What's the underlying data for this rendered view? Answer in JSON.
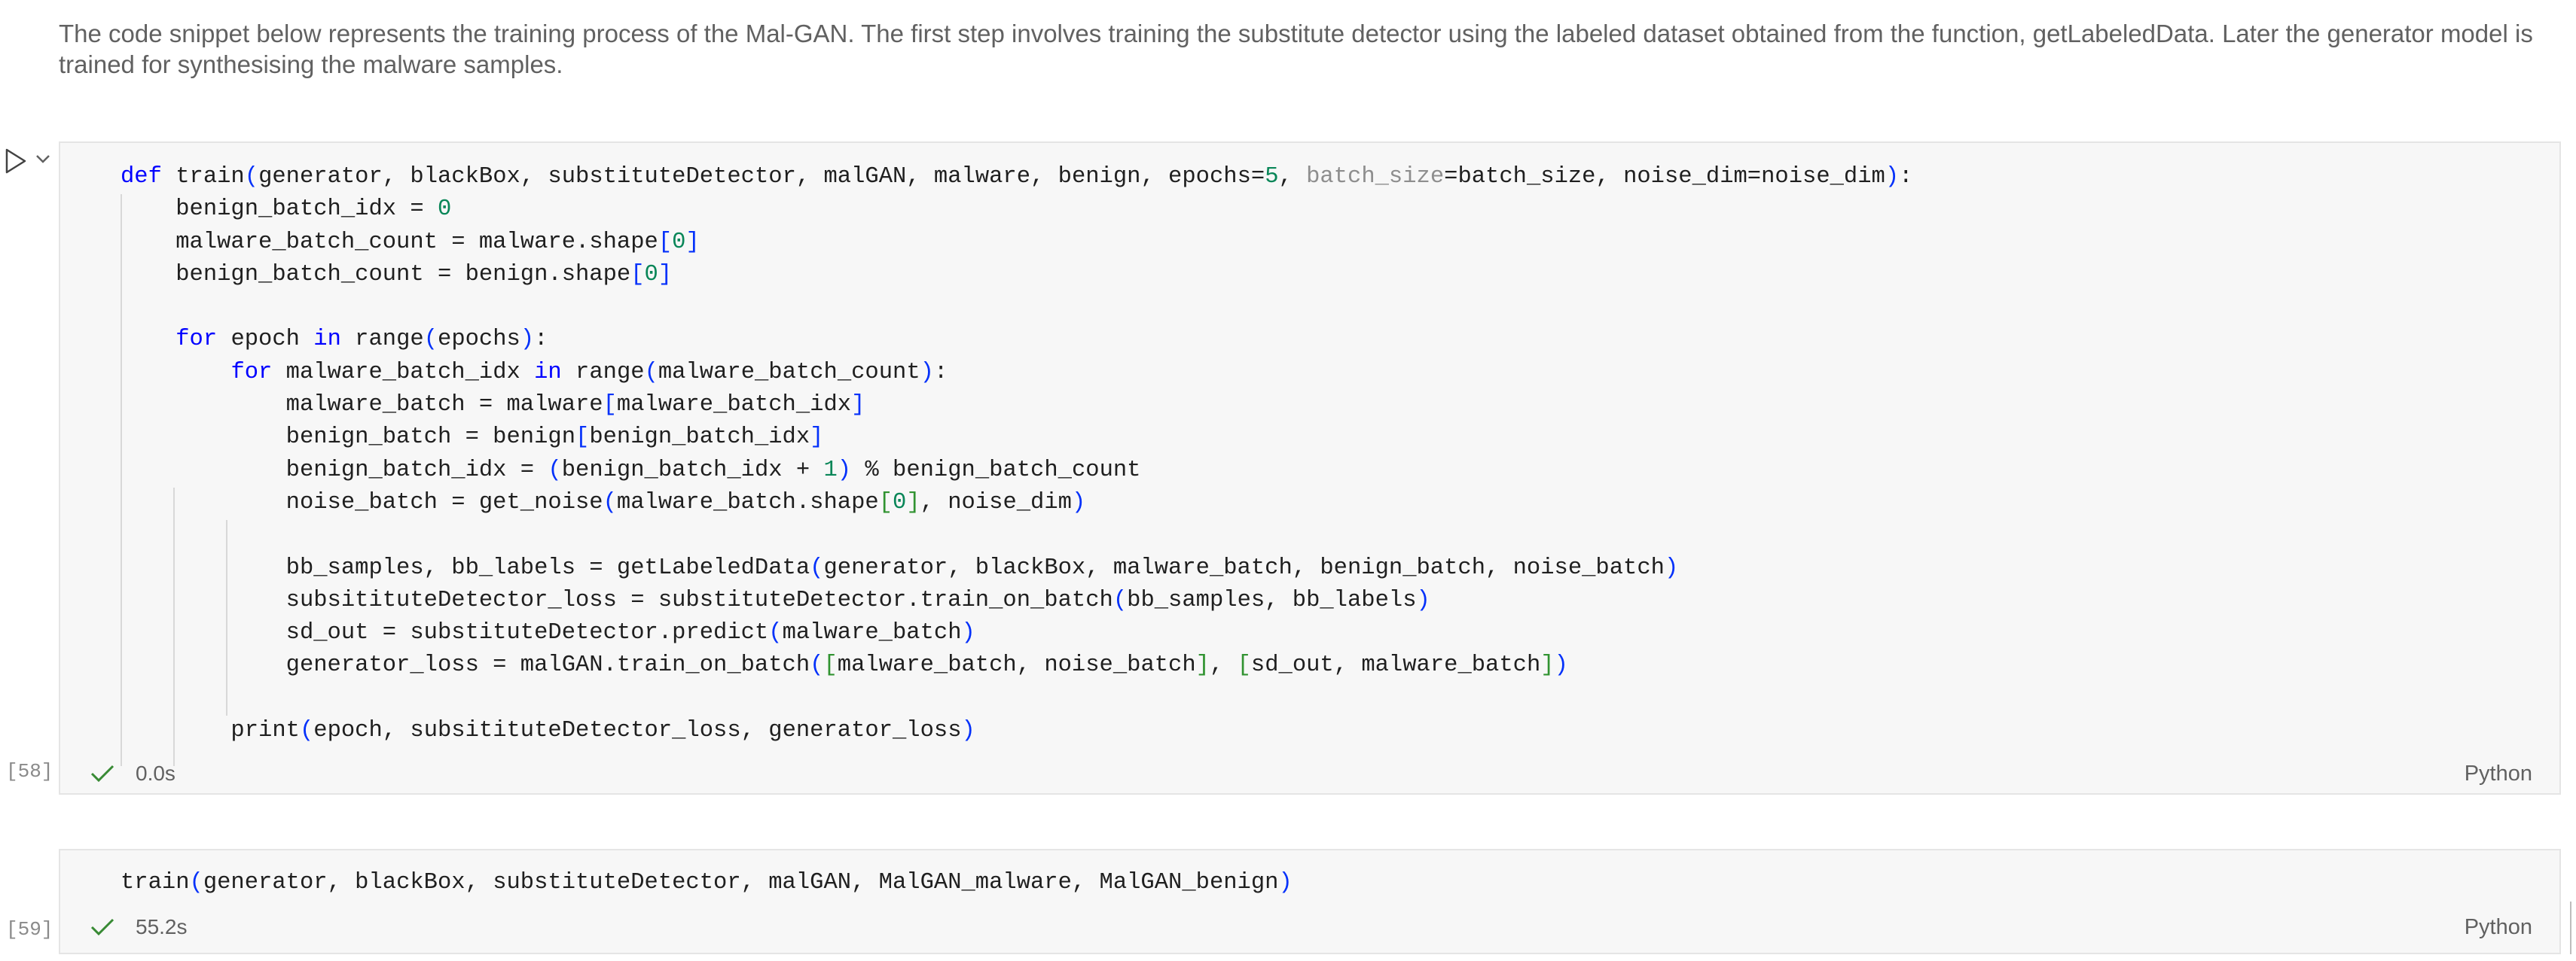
{
  "markdown": {
    "text": "The code snippet below represents the training process of the Mal-GAN. The first step involves training the substitute detector using the labeled dataset obtained from the function, getLabeledData. Later the generator model is trained for synthesising the malware samples."
  },
  "cell1": {
    "exec_count": "[58]",
    "status_time": "0.0s",
    "language": "Python",
    "lines": [
      "def train(generator, blackBox, substituteDetector, malGAN, malware, benign, epochs=5, batch_size=batch_size, noise_dim=noise_dim):",
      "    benign_batch_idx = 0",
      "    malware_batch_count = malware.shape[0]",
      "    benign_batch_count = benign.shape[0]",
      "",
      "    for epoch in range(epochs):",
      "        for malware_batch_idx in range(malware_batch_count):",
      "            malware_batch = malware[malware_batch_idx]",
      "            benign_batch = benign[benign_batch_idx]",
      "            benign_batch_idx = (benign_batch_idx + 1) % benign_batch_count",
      "            noise_batch = get_noise(malware_batch.shape[0], noise_dim)",
      "",
      "            bb_samples, bb_labels = getLabeledData(generator, blackBox, malware_batch, benign_batch, noise_batch)",
      "            subsitituteDetector_loss = substituteDetector.train_on_batch(bb_samples, bb_labels)",
      "            sd_out = substituteDetector.predict(malware_batch)",
      "            generator_loss = malGAN.train_on_batch([malware_batch, noise_batch], [sd_out, malware_batch])",
      "",
      "        print(epoch, subsitituteDetector_loss, generator_loss)"
    ]
  },
  "cell2": {
    "exec_count": "[59]",
    "status_time": "55.2s",
    "language": "Python",
    "lines": [
      "train(generator, blackBox, substituteDetector, malGAN, MalGAN_malware, MalGAN_benign)"
    ]
  }
}
